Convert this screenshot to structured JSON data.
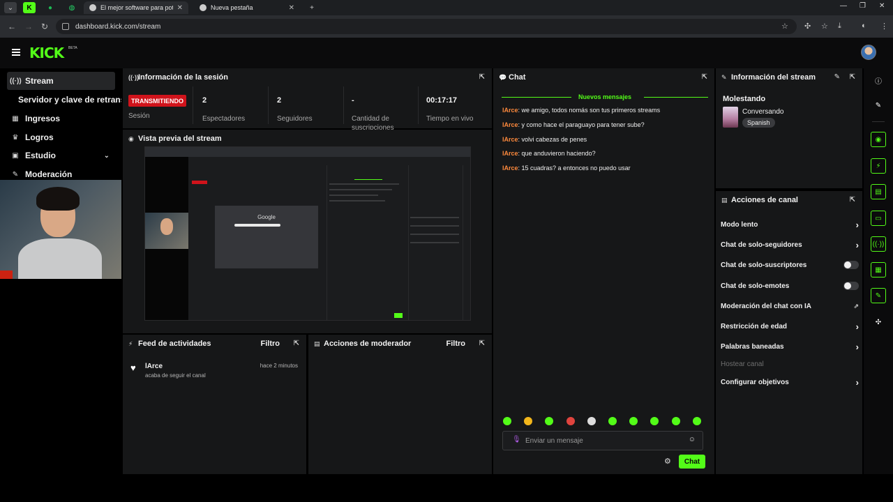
{
  "browser": {
    "tabs": [
      {
        "title": "",
        "icon": "kick-icon"
      },
      {
        "title": "",
        "icon": "spotify-icon"
      },
      {
        "title": "",
        "icon": "whatsapp-icon"
      },
      {
        "title": "El mejor software para potencia",
        "icon": "shield-icon"
      },
      {
        "title": "Nueva pestaña",
        "icon": "globe-icon"
      }
    ],
    "url": "dashboard.kick.com/stream"
  },
  "app": {
    "logo": "KICK",
    "beta": "BETA"
  },
  "sidebar": {
    "items": [
      {
        "label": "Stream",
        "icon": "broadcast-icon"
      },
      {
        "label": "Ingresos",
        "icon": "chart-icon"
      },
      {
        "label": "Logros",
        "icon": "trophy-icon"
      },
      {
        "label": "Estudio",
        "icon": "video-icon"
      },
      {
        "label": "Moderación",
        "icon": "wrench-icon"
      }
    ],
    "sub_item": "Servidor y clave de retransm"
  },
  "session": {
    "title": "Información de la sesión",
    "live_badge": "TRANSMITIENDO",
    "session_label": "Sesión",
    "stats": [
      {
        "value": "2",
        "label": "Espectadores"
      },
      {
        "value": "2",
        "label": "Seguidores"
      },
      {
        "value": "-",
        "label": "Cantidad de suscripciones"
      },
      {
        "value": "00:17:17",
        "label": "Tiempo en vivo"
      }
    ]
  },
  "preview": {
    "title": "Vista previa del stream",
    "inner_search": "Google"
  },
  "feed": {
    "title": "Feed de actividades",
    "filter": "Filtro",
    "items": [
      {
        "user": "lArce",
        "action": "acaba de seguir el canal",
        "time": "hace 2 minutos"
      }
    ]
  },
  "mod": {
    "title": "Acciones de moderador",
    "filter": "Filtro"
  },
  "chat": {
    "title": "Chat",
    "new_messages": "Nuevos mensajes",
    "messages": [
      {
        "user": "lArce",
        "text": ": we amigo, todos nomás son tus primeros streams"
      },
      {
        "user": "lArce",
        "text": ": y como hace el paraguayo para tener sube?"
      },
      {
        "user": "lArce",
        "text": ": volvi cabezas de penes"
      },
      {
        "user": "lArce",
        "text": ": que anduvieron haciendo?"
      },
      {
        "user": "lArce",
        "text": ": 15 cuadras? a entonces no puedo usar"
      }
    ],
    "emote_colors": [
      "#53fc18",
      "#f2b61b",
      "#53fc18",
      "#e0443e",
      "#dddddd",
      "#53fc18",
      "#53fc18",
      "#53fc18",
      "#53fc18",
      "#53fc18"
    ],
    "input_placeholder": "Enviar un mensaje",
    "send_label": "Chat"
  },
  "stream_info": {
    "title": "Información del stream",
    "stream_title": "Molestando",
    "category": "Conversando",
    "language": "Spanish"
  },
  "channel_actions": {
    "title": "Acciones de canal",
    "rows": [
      {
        "label": "Modo lento",
        "control": "chevron"
      },
      {
        "label": "Chat de solo-seguidores",
        "control": "chevron"
      },
      {
        "label": "Chat de solo-suscriptores",
        "control": "toggle"
      },
      {
        "label": "Chat de solo-emotes",
        "control": "toggle"
      },
      {
        "label": "Moderación del chat con IA",
        "control": "external"
      },
      {
        "label": "Restricción de edad",
        "control": "chevron"
      },
      {
        "label": "Palabras baneadas",
        "control": "chevron"
      },
      {
        "label": "Hostear canal",
        "control": "disabled"
      },
      {
        "label": "Configurar objetivos",
        "control": "chevron"
      }
    ]
  },
  "colors": {
    "accent": "#53fc18",
    "live": "#d0131b",
    "username": "#ff8a3d"
  }
}
